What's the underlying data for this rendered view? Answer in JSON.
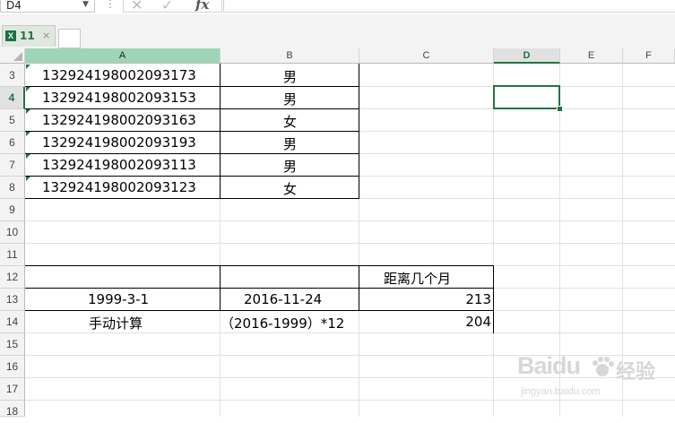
{
  "formula_bar": {
    "cell_ref": "D4",
    "fx_label": "fx",
    "formula": ""
  },
  "sheet_tab": {
    "label": "11",
    "app_icon_label": "X"
  },
  "selected_cell": "D4",
  "columns": [
    "A",
    "B",
    "C",
    "D",
    "E",
    "F"
  ],
  "rows": [
    "3",
    "4",
    "5",
    "6",
    "7",
    "8",
    "9",
    "10",
    "11",
    "12",
    "13",
    "14",
    "15",
    "16",
    "17",
    "18"
  ],
  "cells": {
    "A3": "132924198002093173",
    "B3": "男",
    "A4": "132924198002093153",
    "B4": "男",
    "A5": "132924198002093163",
    "B5": "女",
    "A6": "132924198002093193",
    "B6": "男",
    "A7": "132924198002093113",
    "B7": "男",
    "A8": "132924198002093123",
    "B8": "女",
    "C12": "距离几个月",
    "A13": "1999-3-1",
    "B13": "2016-11-24",
    "C13": "213",
    "A14": "手动计算",
    "B14": "（2016-1999）*12",
    "C14": "204"
  },
  "watermark": {
    "brand": "Baidu",
    "brand_cn": "经验",
    "url": "jingyan.baidu.com"
  },
  "colors": {
    "accent": "#217346",
    "header_selected": "#9fd5b7",
    "gridline": "#e1e1e1"
  }
}
